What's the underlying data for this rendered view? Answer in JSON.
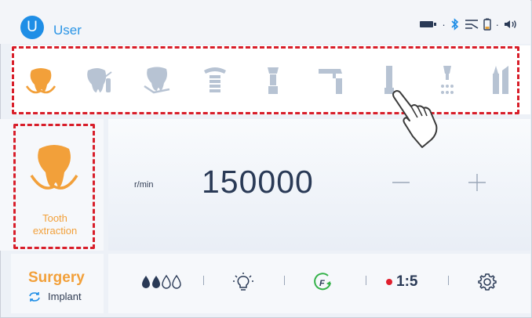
{
  "header": {
    "avatar_letter": "U",
    "user_label": "User",
    "status_dot_1": "·",
    "status_dot_2": "·",
    "status_icons": [
      "battery-low-icon",
      "bluetooth-icon",
      "signal-icon",
      "battery-level-icon",
      "volume-icon"
    ]
  },
  "toolbar": {
    "tools": [
      {
        "name": "tooth-extraction-tool",
        "icon": "tooth-extraction-icon",
        "active": true
      },
      {
        "name": "endo-tool",
        "icon": "tooth-endo-icon",
        "active": false
      },
      {
        "name": "tooth-scaling-tool",
        "icon": "tooth-scaling-icon",
        "active": false
      },
      {
        "name": "implant-tool",
        "icon": "implant-icon",
        "active": false
      },
      {
        "name": "straight-handpiece-tool",
        "icon": "straight-handpiece-icon",
        "active": false
      },
      {
        "name": "contra-angle-tool",
        "icon": "contra-angle-icon",
        "active": false
      },
      {
        "name": "bone-saw-tool",
        "icon": "bone-saw-icon",
        "active": false
      },
      {
        "name": "irrigation-tool",
        "icon": "irrigation-icon",
        "active": false
      },
      {
        "name": "piezo-tool",
        "icon": "piezo-handpiece-icon",
        "active": false
      }
    ]
  },
  "mode": {
    "label_line1": "Tooth",
    "label_line2": "extraction"
  },
  "speed": {
    "unit": "r/min",
    "value": "150000",
    "minus_label": "—",
    "plus_label": "+"
  },
  "surgery": {
    "title": "Surgery",
    "sub_label": "Implant"
  },
  "bottom": {
    "irrigation_level": 2,
    "irrigation_max": 4,
    "ratio": "1:5",
    "direction_letter": "F"
  },
  "colors": {
    "accent_orange": "#f2a03a",
    "accent_blue": "#1f8ee6",
    "dash_red": "#d81e2a",
    "icon_grey": "#b7c3d3",
    "text_dark": "#2a3a56"
  }
}
